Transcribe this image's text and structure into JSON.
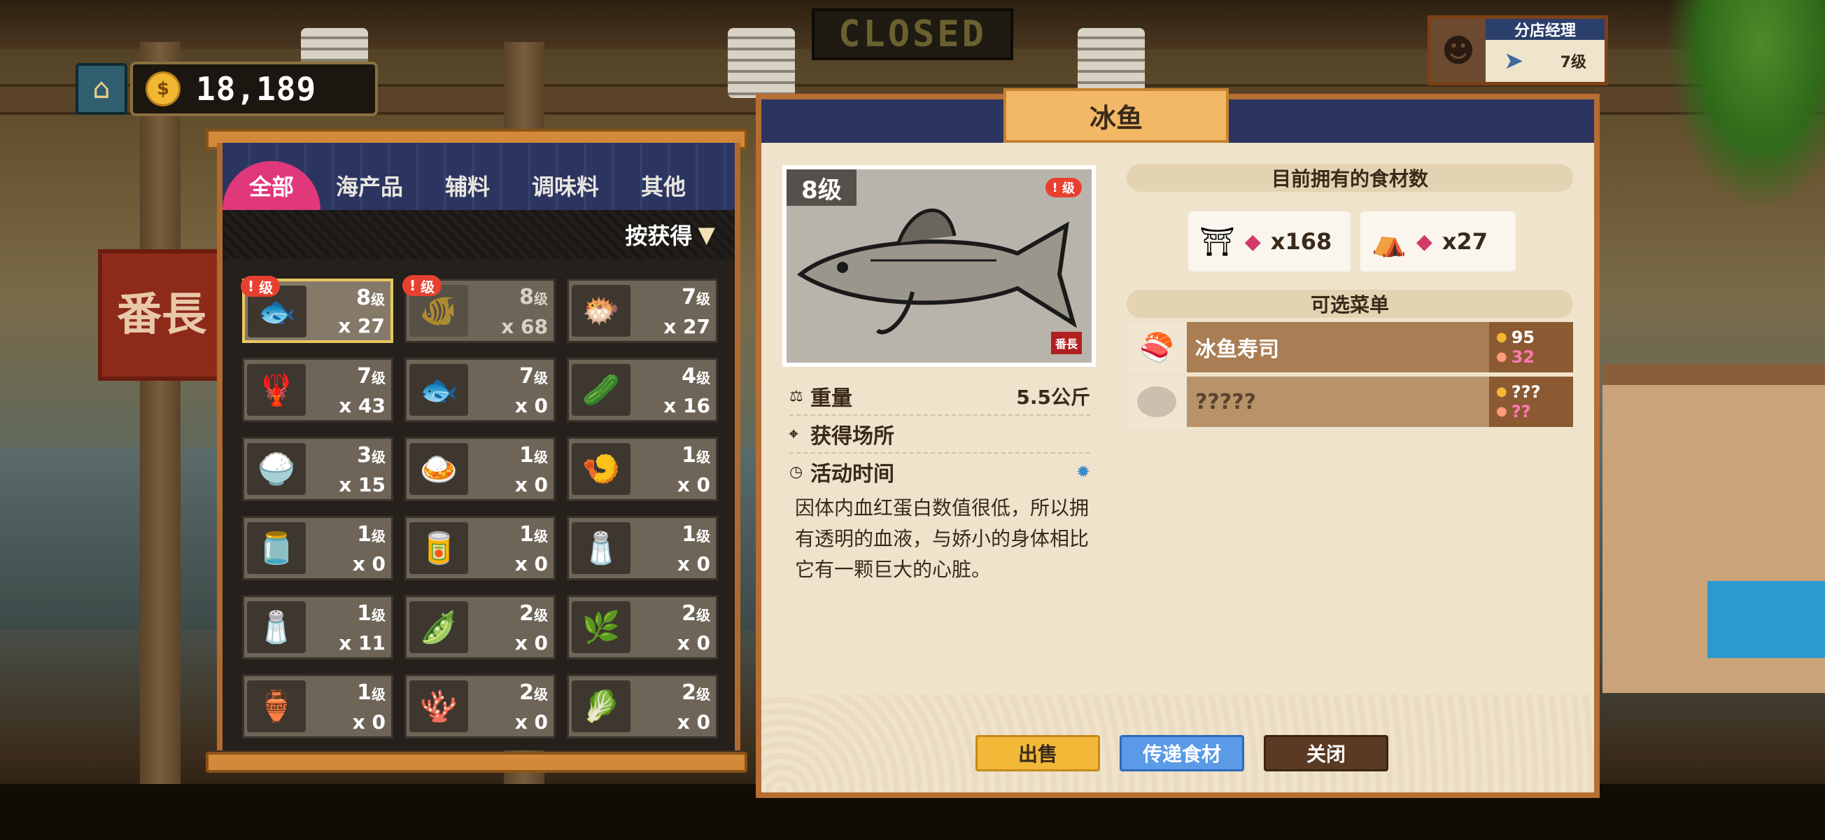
{
  "scene": {
    "closed_sign": "CLOSED",
    "shop_sign": "番長"
  },
  "hud": {
    "home_icon": "hut-icon",
    "coin_symbol": "$",
    "money": "18,189"
  },
  "manager": {
    "title": "分店经理",
    "level": "7级"
  },
  "inventory": {
    "tabs": [
      "全部",
      "海产品",
      "辅料",
      "调味料",
      "其他"
    ],
    "active_tab": 0,
    "sort_label": "按获得",
    "sort_arrow": "▼",
    "items": [
      {
        "icon": "ice-fish-icon",
        "glyph": "🐟",
        "level": "8",
        "qty": "x 27",
        "badge": "级",
        "state": "selected"
      },
      {
        "icon": "red-fish-icon",
        "glyph": "🐠",
        "level": "8",
        "qty": "x 68",
        "badge": "级",
        "state": "dim"
      },
      {
        "icon": "blob-fish-icon",
        "glyph": "🐡",
        "level": "7",
        "qty": "x 27",
        "badge": "",
        "state": ""
      },
      {
        "icon": "blue-crab-fish-icon",
        "glyph": "🦞",
        "level": "7",
        "qty": "x 43",
        "badge": "",
        "state": ""
      },
      {
        "icon": "dark-fish-icon",
        "glyph": "🐟",
        "level": "7",
        "qty": "x 0",
        "badge": "",
        "state": ""
      },
      {
        "icon": "cucumber-icon",
        "glyph": "🥒",
        "level": "4",
        "qty": "x 16",
        "badge": "",
        "state": ""
      },
      {
        "icon": "rice-bag-icon",
        "glyph": "🍚",
        "level": "3",
        "qty": "x 15",
        "badge": "",
        "state": ""
      },
      {
        "icon": "curry-box-icon",
        "glyph": "🍛",
        "level": "1",
        "qty": "x 0",
        "badge": "",
        "state": ""
      },
      {
        "icon": "fried-item-icon",
        "glyph": "🍤",
        "level": "1",
        "qty": "x 0",
        "badge": "",
        "state": ""
      },
      {
        "icon": "pepper-jar-icon",
        "glyph": "🫙",
        "level": "1",
        "qty": "x 0",
        "badge": "",
        "state": ""
      },
      {
        "icon": "mayo-jar-icon",
        "glyph": "🥫",
        "level": "1",
        "qty": "x 0",
        "badge": "",
        "state": ""
      },
      {
        "icon": "spice-jar-icon",
        "glyph": "🧂",
        "level": "1",
        "qty": "x 0",
        "badge": "",
        "state": ""
      },
      {
        "icon": "salt-bottle-icon",
        "glyph": "🧂",
        "level": "1",
        "qty": "x 11",
        "badge": "",
        "state": ""
      },
      {
        "icon": "green-pod-icon",
        "glyph": "🫛",
        "level": "2",
        "qty": "x 0",
        "badge": "",
        "state": ""
      },
      {
        "icon": "herb-leaf-icon",
        "glyph": "🌿",
        "level": "2",
        "qty": "x 0",
        "badge": "",
        "state": ""
      },
      {
        "icon": "miso-jar-icon",
        "glyph": "🏺",
        "level": "1",
        "qty": "x 0",
        "badge": "",
        "state": ""
      },
      {
        "icon": "coral-icon",
        "glyph": "🪸",
        "level": "2",
        "qty": "x 0",
        "badge": "",
        "state": ""
      },
      {
        "icon": "seaweed-icon",
        "glyph": "🥬",
        "level": "2",
        "qty": "x 0",
        "badge": "",
        "state": ""
      }
    ],
    "level_suffix": "级"
  },
  "detail": {
    "title": "冰鱼",
    "level": "8级",
    "badge": "级",
    "stamp": "番長",
    "weight_label": "重量",
    "weight_value": "5.5公斤",
    "location_label": "获得场所",
    "time_label": "活动时间",
    "description": "因体内血红蛋白数值很低，所以拥有透明的血液，与娇小的身体相比它有一颗巨大的心脏。",
    "owned_header": "目前拥有的食材数",
    "owned": [
      {
        "shop_icon": "shop-icon",
        "count": "x168"
      },
      {
        "shop_icon": "restaurant-icon",
        "count": "x27"
      }
    ],
    "menu_header": "可选菜单",
    "menu": [
      {
        "name": "冰鱼寿司",
        "gold": "95",
        "taste": "32",
        "icon": "sushi-icon",
        "locked": false
      },
      {
        "name": "?????",
        "gold": "???",
        "taste": "??",
        "icon": "unknown-dish-icon",
        "locked": true
      }
    ],
    "buttons": {
      "sell": "出售",
      "transfer": "传递食材",
      "close": "关闭"
    }
  },
  "colors": {
    "tab_active": "#e0387a",
    "panel_navy": "#2c3560",
    "frame_orange": "#b66e33",
    "sell_yellow": "#f2b838",
    "transfer_blue": "#5a9ae6",
    "close_brown": "#5a3a22"
  }
}
